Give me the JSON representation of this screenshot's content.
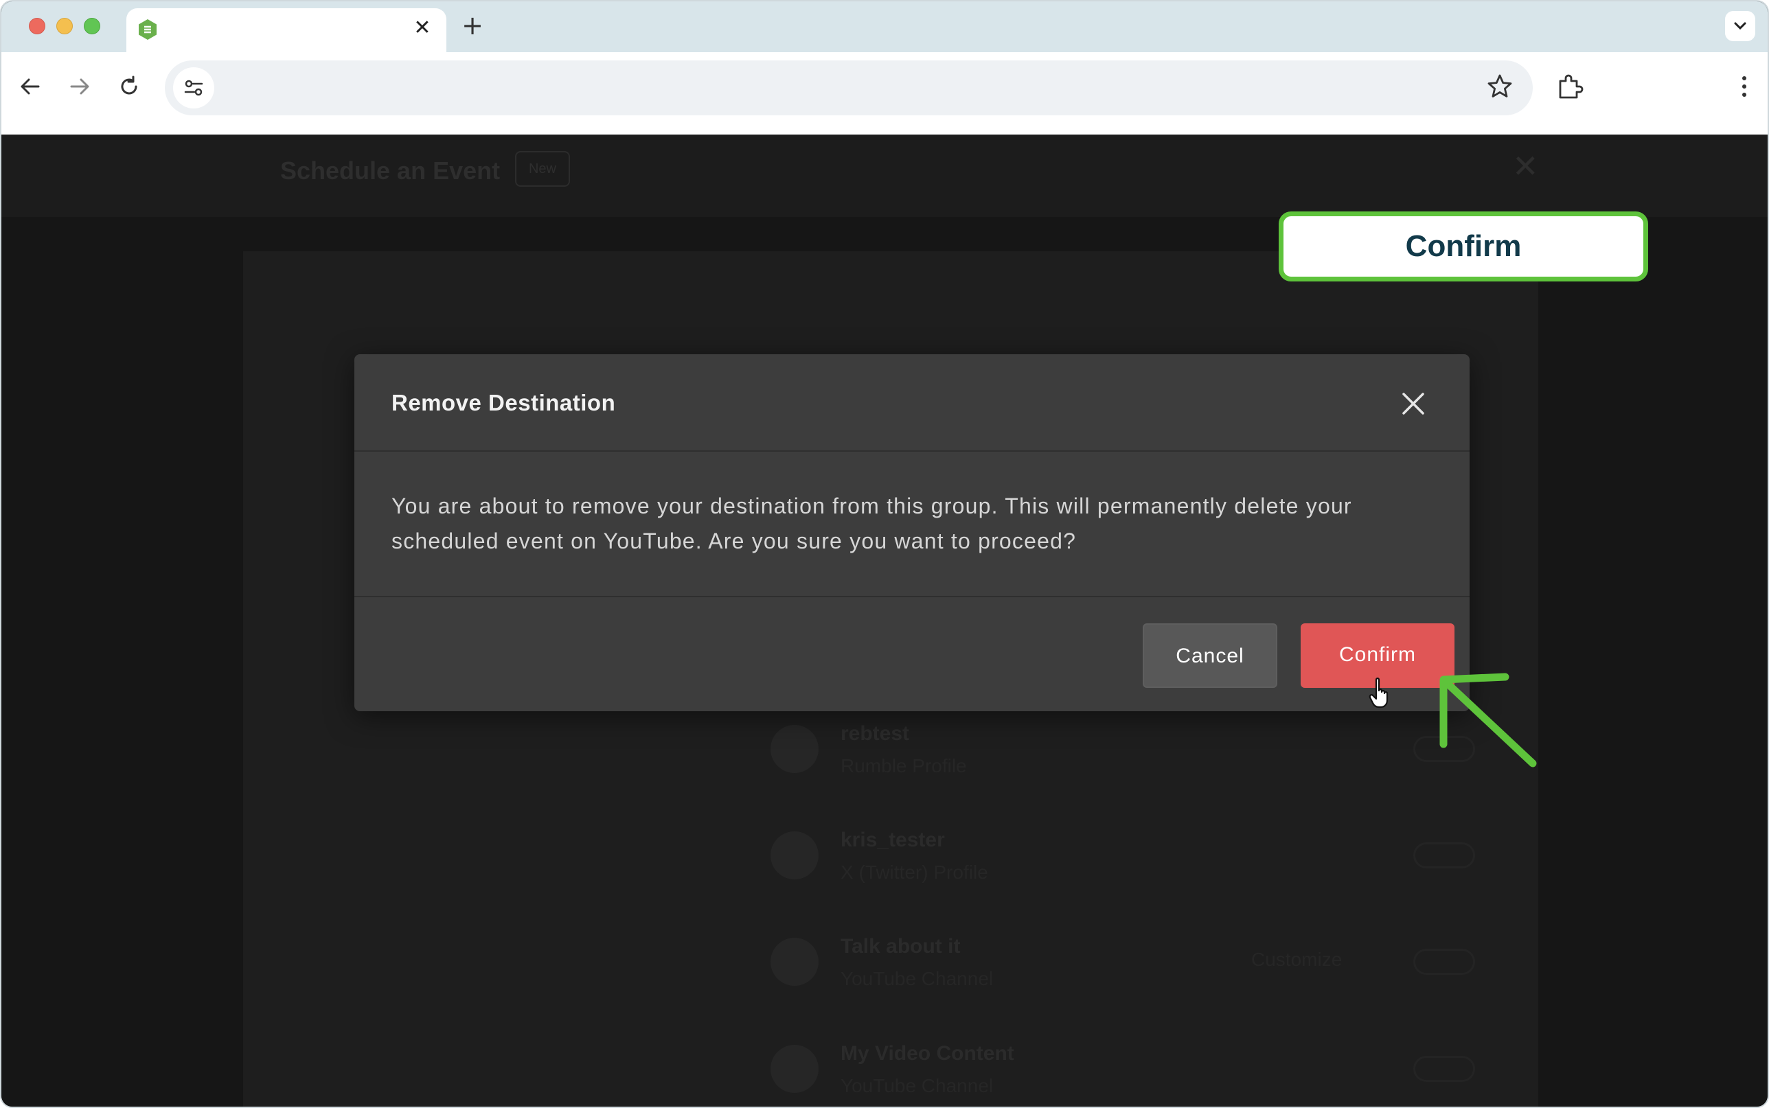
{
  "browser": {
    "tab_title": "",
    "tab_close_glyph": "✕",
    "new_tab_glyph": "+",
    "address": ""
  },
  "background_page": {
    "modal_title": "Schedule an Event",
    "badge": "New",
    "close_glyph": "✕",
    "destinations": [
      {
        "name": "rebtest",
        "type": "Rumble Profile"
      },
      {
        "name": "kris_tester",
        "type": "X (Twitter) Profile"
      },
      {
        "name": "Talk about it",
        "type": "YouTube Channel",
        "action": "Customize"
      },
      {
        "name": "My Video Content",
        "type": "YouTube Channel"
      }
    ]
  },
  "dialog": {
    "title": "Remove Destination",
    "body": "You are about to remove your destination from this group. This will permanently delete your scheduled event on YouTube. Are you sure you want to proceed?",
    "cancel_label": "Cancel",
    "confirm_label": "Confirm"
  },
  "callout": {
    "label": "Confirm"
  },
  "colors": {
    "confirm_button": "#e05656",
    "callout_border": "#5ec33b",
    "callout_text": "#123a4a",
    "dialog_bg": "#3d3d3d"
  }
}
